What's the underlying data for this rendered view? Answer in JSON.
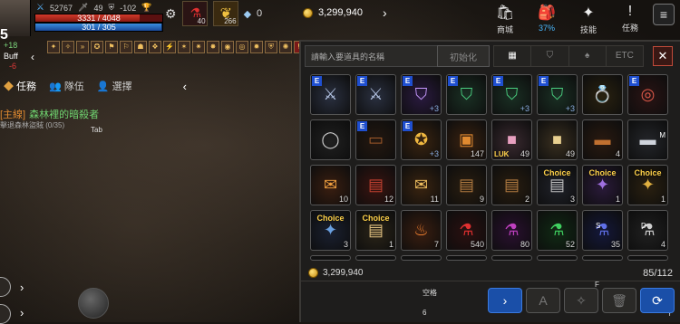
{
  "hud": {
    "level": "5",
    "combat_power": "52767",
    "stat2": "49",
    "stat3": "-102",
    "hp": "3331 / 4048",
    "hp_fraction": 0.82,
    "mp": "301 / 305",
    "mp_fraction": 0.99,
    "buff_plus": "+18",
    "buff_label": "Buff",
    "buff_neg": "-6",
    "potion_count": "40",
    "feather_count": "266",
    "gem_count": "0",
    "gold_top": "3,299,940"
  },
  "left_panel": {
    "tabs": [
      "任務",
      "隊伍",
      "選擇"
    ],
    "quest_tag": "[主線]",
    "quest_name": "森林裡的暗殺者",
    "quest_sub": "擊退森林盜賊 (0/35)",
    "tab_key": "Tab"
  },
  "top_right": [
    {
      "icon": "shop-icon",
      "glyph": "🛍",
      "label": "商城"
    },
    {
      "icon": "bag-icon",
      "glyph": "🎒",
      "label": "37%"
    },
    {
      "icon": "skill-icon",
      "glyph": "✦",
      "label": "技能"
    },
    {
      "icon": "quest-icon",
      "glyph": "!",
      "label": "任務"
    }
  ],
  "inventory": {
    "search_placeholder": "請輸入要道具的名稱",
    "reset_label": "初始化",
    "filters": [
      "▦",
      "⛉",
      "♠",
      "ETC"
    ],
    "close_label": "✕",
    "gold": "3,299,940",
    "slots": "85/112",
    "key_space": "空格",
    "key_6": "6",
    "key_f": "F",
    "key_y": "Y",
    "btn_a": "A",
    "items": [
      {
        "name": "silver-sword-amulet",
        "glyph": "⚔",
        "color": "#b8c8e8",
        "bg": "#2a3040",
        "e": true,
        "plus": ""
      },
      {
        "name": "silver-sword-amulet",
        "glyph": "⚔",
        "color": "#b8c8e8",
        "bg": "#2a3040",
        "e": true,
        "plus": ""
      },
      {
        "name": "purple-shield-amulet",
        "glyph": "⛉",
        "color": "#c89aff",
        "bg": "#2a1a40",
        "e": true,
        "plus": "+3"
      },
      {
        "name": "green-shield-amulet",
        "glyph": "⛉",
        "color": "#4ad080",
        "bg": "#1a3024",
        "e": true,
        "plus": ""
      },
      {
        "name": "green-shield-amulet",
        "glyph": "⛉",
        "color": "#4ad080",
        "bg": "#1a3024",
        "e": true,
        "plus": "+3"
      },
      {
        "name": "green-shield-amulet",
        "glyph": "⛉",
        "color": "#4ad080",
        "bg": "#1a3024",
        "e": true,
        "plus": "+3"
      },
      {
        "name": "emerald-ring",
        "glyph": "💍",
        "color": "#e0b040",
        "bg": "#2a2210",
        "e": false,
        "plus": ""
      },
      {
        "name": "red-ring",
        "glyph": "◎",
        "color": "#e05a4a",
        "bg": "#2a1414",
        "e": true,
        "plus": ""
      },
      {
        "name": "silver-ring",
        "glyph": "◯",
        "color": "#ccc",
        "bg": "#202020",
        "e": false,
        "plus": ""
      },
      {
        "name": "leather-belt",
        "glyph": "▭",
        "color": "#a05a2a",
        "bg": "#241810",
        "e": true,
        "plus": ""
      },
      {
        "name": "gold-crest",
        "glyph": "✪",
        "color": "#f0b840",
        "bg": "#3a2410",
        "e": true,
        "plus": "+3"
      },
      {
        "name": "orange-chest",
        "glyph": "▣",
        "color": "#e08a30",
        "bg": "#3a2210",
        "e": false,
        "plus": "",
        "count": "147"
      },
      {
        "name": "luk-box",
        "glyph": "■",
        "color": "#e8a0c0",
        "bg": "#3a2a30",
        "e": false,
        "plus": "",
        "count": "49",
        "luk": "LUK"
      },
      {
        "name": "gold-box",
        "glyph": "■",
        "color": "#e8d090",
        "bg": "#3a3020",
        "e": false,
        "plus": "",
        "count": "49"
      },
      {
        "name": "bronze-box",
        "glyph": "▬",
        "color": "#c07030",
        "bg": "#2a1a10",
        "e": false,
        "plus": "",
        "count": "4"
      },
      {
        "name": "silver-box",
        "glyph": "▬",
        "color": "#cfd4dc",
        "bg": "#24262a",
        "e": false,
        "plus": "",
        "key": "M"
      },
      {
        "name": "treasure-chest-gold",
        "glyph": "✉",
        "color": "#f0a040",
        "bg": "#3a1e10",
        "e": false,
        "plus": "",
        "count": "10"
      },
      {
        "name": "treasure-chest-red",
        "glyph": "▤",
        "color": "#c04030",
        "bg": "#3a1410",
        "e": false,
        "plus": "",
        "count": "12"
      },
      {
        "name": "treasure-chest-light",
        "glyph": "✉",
        "color": "#f0c060",
        "bg": "#3a2410",
        "e": false,
        "plus": "",
        "count": "11"
      },
      {
        "name": "wood-chest",
        "glyph": "▤",
        "color": "#b07a40",
        "bg": "#2a1e10",
        "e": false,
        "plus": "",
        "count": "9"
      },
      {
        "name": "wood-chest",
        "glyph": "▤",
        "color": "#b07a40",
        "bg": "#2a1e10",
        "e": false,
        "plus": "",
        "count": "2"
      },
      {
        "name": "choice-chest",
        "glyph": "▤",
        "color": "#c0c0c0",
        "bg": "#20222a",
        "e": false,
        "plus": "",
        "count": "3",
        "choice": "Choice"
      },
      {
        "name": "choice-chest",
        "glyph": "✦",
        "color": "#a070e0",
        "bg": "#2a1a3a",
        "e": false,
        "plus": "",
        "count": "1",
        "choice": "Choice"
      },
      {
        "name": "choice-chest",
        "glyph": "✦",
        "color": "#e0b040",
        "bg": "#2a2010",
        "e": false,
        "plus": "",
        "count": "1",
        "choice": "Choice"
      },
      {
        "name": "choice-chest",
        "glyph": "✦",
        "color": "#6aa0e0",
        "bg": "#1a2030",
        "e": false,
        "plus": "",
        "count": "3",
        "choice": "Choice"
      },
      {
        "name": "choice-chest",
        "glyph": "▤",
        "color": "#e0c080",
        "bg": "#2a2418",
        "e": false,
        "plus": "",
        "count": "1",
        "choice": "Choice"
      },
      {
        "name": "fire-potion",
        "glyph": "♨",
        "color": "#f08030",
        "bg": "#3a1e10",
        "e": false,
        "plus": "",
        "count": "7"
      },
      {
        "name": "red-potion",
        "glyph": "⚗",
        "color": "#e03030",
        "bg": "#2a1010",
        "e": false,
        "plus": "",
        "count": "540"
      },
      {
        "name": "purple-potion",
        "glyph": "⚗",
        "color": "#c040c0",
        "bg": "#2a1030",
        "e": false,
        "plus": "",
        "count": "80"
      },
      {
        "name": "green-potion",
        "glyph": "⚗",
        "color": "#40d060",
        "bg": "#102a14",
        "e": false,
        "plus": "",
        "count": "52"
      },
      {
        "name": "blue-potion",
        "glyph": "⚗",
        "color": "#6070e8",
        "bg": "#14183a",
        "e": false,
        "plus": "",
        "count": "35",
        "keyl": "S"
      },
      {
        "name": "clear-potion",
        "glyph": "⚗",
        "color": "#d0d0d0",
        "bg": "#202020",
        "e": false,
        "plus": "",
        "count": "4",
        "keyl": "D"
      }
    ]
  }
}
